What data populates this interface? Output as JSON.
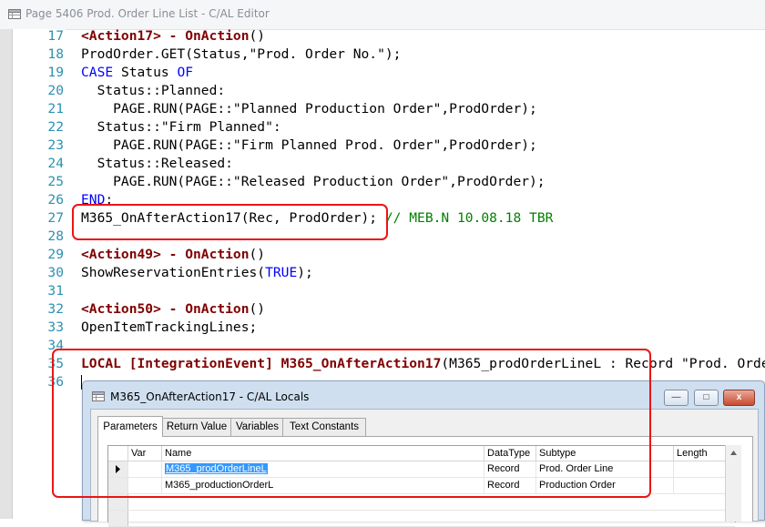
{
  "window": {
    "title": "Page 5406 Prod. Order Line List - C/AL Editor"
  },
  "code_lines": [
    {
      "num": "17",
      "tokens": [
        {
          "t": "<Action17> - OnAction",
          "c": "tr"
        },
        {
          "t": "()",
          "c": ""
        }
      ]
    },
    {
      "num": "18",
      "tokens": [
        {
          "t": "ProdOrder.GET(Status,\"Prod. Order No.\");",
          "c": ""
        }
      ]
    },
    {
      "num": "19",
      "tokens": [
        {
          "t": "CASE",
          "c": "kw"
        },
        {
          "t": " Status ",
          "c": ""
        },
        {
          "t": "OF",
          "c": "kw"
        }
      ]
    },
    {
      "num": "20",
      "tokens": [
        {
          "t": "  Status::Planned:",
          "c": ""
        }
      ]
    },
    {
      "num": "21",
      "tokens": [
        {
          "t": "    PAGE.RUN(PAGE::\"Planned Production Order\",ProdOrder);",
          "c": ""
        }
      ]
    },
    {
      "num": "22",
      "tokens": [
        {
          "t": "  Status::\"Firm Planned\":",
          "c": ""
        }
      ]
    },
    {
      "num": "23",
      "tokens": [
        {
          "t": "    PAGE.RUN(PAGE::\"Firm Planned Prod. Order\",ProdOrder);",
          "c": ""
        }
      ]
    },
    {
      "num": "24",
      "tokens": [
        {
          "t": "  Status::Released:",
          "c": ""
        }
      ]
    },
    {
      "num": "25",
      "tokens": [
        {
          "t": "    PAGE.RUN(PAGE::\"Released Production Order\",ProdOrder);",
          "c": ""
        }
      ]
    },
    {
      "num": "26",
      "tokens": [
        {
          "t": "END",
          "c": "kw"
        },
        {
          "t": ";",
          "c": ""
        }
      ]
    },
    {
      "num": "27",
      "tokens": [
        {
          "t": "M365_OnAfterAction17(Rec, ProdOrder);",
          "c": ""
        },
        {
          "t": " ",
          "c": ""
        },
        {
          "t": "// MEB.N 10.08.18 TBR",
          "c": "cm"
        }
      ]
    },
    {
      "num": "28",
      "tokens": []
    },
    {
      "num": "29",
      "tokens": [
        {
          "t": "<Action49> - OnAction",
          "c": "tr"
        },
        {
          "t": "()",
          "c": ""
        }
      ]
    },
    {
      "num": "30",
      "tokens": [
        {
          "t": "ShowReservationEntries(",
          "c": ""
        },
        {
          "t": "TRUE",
          "c": "kw"
        },
        {
          "t": ");",
          "c": ""
        }
      ]
    },
    {
      "num": "31",
      "tokens": []
    },
    {
      "num": "32",
      "tokens": [
        {
          "t": "<Action50> - OnAction",
          "c": "tr"
        },
        {
          "t": "()",
          "c": ""
        }
      ]
    },
    {
      "num": "33",
      "tokens": [
        {
          "t": "OpenItemTrackingLines;",
          "c": ""
        }
      ]
    },
    {
      "num": "34",
      "tokens": []
    },
    {
      "num": "35",
      "tokens": [
        {
          "t": "LOCAL [IntegrationEvent] M365_OnAfterAction17",
          "c": "tr"
        },
        {
          "t": "(M365_prodOrderLineL : Record \"Prod. Orde",
          "c": ""
        }
      ]
    },
    {
      "num": "36",
      "tokens": []
    }
  ],
  "locals_dialog": {
    "title": "M365_OnAfterAction17 - C/AL Locals",
    "tabs": [
      "Parameters",
      "Return Value",
      "Variables",
      "Text Constants"
    ],
    "active_tab": "Parameters",
    "columns": [
      "Var",
      "Name",
      "DataType",
      "Subtype",
      "Length"
    ],
    "rows": [
      {
        "var": "",
        "name": "M365_prodOrderLineL",
        "datatype": "Record",
        "subtype": "Prod. Order Line",
        "length": ""
      },
      {
        "var": "",
        "name": "M365_productionOrderL",
        "datatype": "Record",
        "subtype": "Production Order",
        "length": ""
      }
    ],
    "buttons": {
      "minimize": "—",
      "maximize": "□",
      "close": "x"
    }
  },
  "colors": {
    "keyword": "#0000ff",
    "trigger": "#800000",
    "comment": "#008000",
    "line_number": "#2b91af",
    "annotation": "#ea1515"
  }
}
